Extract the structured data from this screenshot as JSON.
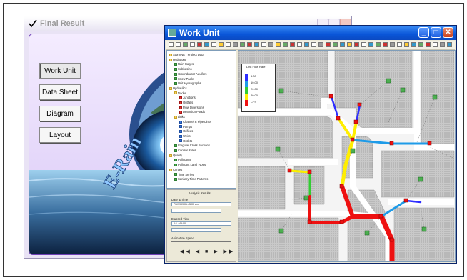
{
  "back_window": {
    "title": "Final Result",
    "buttons": [
      "Work Unit",
      "Data Sheet",
      "Diagram",
      "Layout"
    ],
    "logo_text": "E-Rain"
  },
  "front_window": {
    "title": "Work Unit"
  },
  "tree": [
    {
      "label": "StormNET Project Data",
      "icon": "fold",
      "depth": 0
    },
    {
      "label": "Hydrology",
      "icon": "fold",
      "depth": 0
    },
    {
      "label": "Rain Gages",
      "icon": "gr",
      "depth": 1
    },
    {
      "label": "Subbasins",
      "icon": "gr",
      "depth": 1
    },
    {
      "label": "Groundwater Aquifers",
      "icon": "gr",
      "depth": 1
    },
    {
      "label": "Snow Packs",
      "icon": "gr",
      "depth": 1
    },
    {
      "label": "Unit Hydrographs",
      "icon": "gr",
      "depth": 1
    },
    {
      "label": "Hydraulics",
      "icon": "fold",
      "depth": 0
    },
    {
      "label": "Nodes",
      "icon": "fold",
      "depth": 1
    },
    {
      "label": "Junctions",
      "icon": "rd",
      "depth": 2
    },
    {
      "label": "Outfalls",
      "icon": "rd",
      "depth": 2
    },
    {
      "label": "Flow Diversions",
      "icon": "rd",
      "depth": 2
    },
    {
      "label": "Detention Ponds",
      "icon": "rd",
      "depth": 2
    },
    {
      "label": "Links",
      "icon": "fold",
      "depth": 1
    },
    {
      "label": "Channel & Pipe Links",
      "icon": "bl",
      "depth": 2
    },
    {
      "label": "Pumps",
      "icon": "bl",
      "depth": 2
    },
    {
      "label": "Orifices",
      "icon": "bl",
      "depth": 2
    },
    {
      "label": "Weirs",
      "icon": "bl",
      "depth": 2
    },
    {
      "label": "Outlets",
      "icon": "bl",
      "depth": 2
    },
    {
      "label": "Irregular Cross Sections",
      "icon": "gr",
      "depth": 1
    },
    {
      "label": "Control Rules",
      "icon": "gr",
      "depth": 1
    },
    {
      "label": "Quality",
      "icon": "fold",
      "depth": 0
    },
    {
      "label": "Pollutants",
      "icon": "gr",
      "depth": 1
    },
    {
      "label": "Pollutant Land Types",
      "icon": "gr",
      "depth": 1
    },
    {
      "label": "Curves",
      "icon": "fold",
      "depth": 0
    },
    {
      "label": "Time Series",
      "icon": "gr",
      "depth": 1
    },
    {
      "label": "Sanitary Time Patterns",
      "icon": "gr",
      "depth": 1
    }
  ],
  "results_panel": {
    "heading": "Analysis Results",
    "date_label": "Date & Time",
    "date_value": "7/1/1999 01:45:00 am",
    "elapsed_label": "Elapsed Time",
    "elapsed_value": "0:1 : 45:00",
    "speed_label": "Animation Speed"
  },
  "legend": {
    "title": "Link Flow Rate",
    "entries": [
      {
        "label": "5.00",
        "color": "#2d2dff"
      },
      {
        "label": "10.00",
        "color": "#1e9be8"
      },
      {
        "label": "20.00",
        "color": "#33cc33"
      },
      {
        "label": "40.00",
        "color": "#ffee00"
      },
      {
        "label": "CFS",
        "color": "#ee1111"
      }
    ]
  },
  "colors": {
    "title_bar": "#0a56d8",
    "accent_purple": "#6d3fb5"
  }
}
